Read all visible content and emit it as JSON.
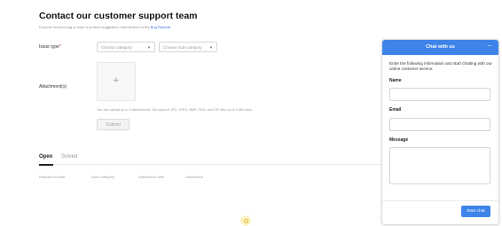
{
  "header": {
    "title": "Contact our customer support team",
    "subtitle_prefix": "If you've found a bug or have a product suggestion, submit them in the ",
    "subtitle_link": "Bug Reports",
    "subtitle_suffix": "."
  },
  "form": {
    "issue_type_label": "Issue type",
    "required_mark": "*",
    "category_placeholder": "Choose category",
    "subcategory_placeholder": "Choose sub-category",
    "attachments_label": "Attachment(s)",
    "upload_icon": "plus-icon",
    "upload_glyph": "+",
    "upload_hint": "You can upload up to 3 attachments. We support JPG, JPEG, BMP, PNG, and GIF files up to 5 MB each.",
    "submit_label": "Submit"
  },
  "tabs": [
    {
      "label": "Open",
      "active": true
    },
    {
      "label": "Solved",
      "active": false
    }
  ],
  "table": {
    "columns": [
      "Request number",
      "Issue category",
      "Submission time",
      "Description"
    ]
  },
  "chat": {
    "title": "Chat with us",
    "minimize_glyph": "–",
    "intro": "Enter the following information and start chatting with our online customer service.",
    "fields": [
      {
        "label": "Name"
      },
      {
        "label": "Email"
      },
      {
        "label": "Message"
      }
    ],
    "start_label": "Start chat"
  },
  "colors": {
    "accent": "#3e84e8",
    "link": "#2f6fd6",
    "loader": "#fdf3c6"
  }
}
